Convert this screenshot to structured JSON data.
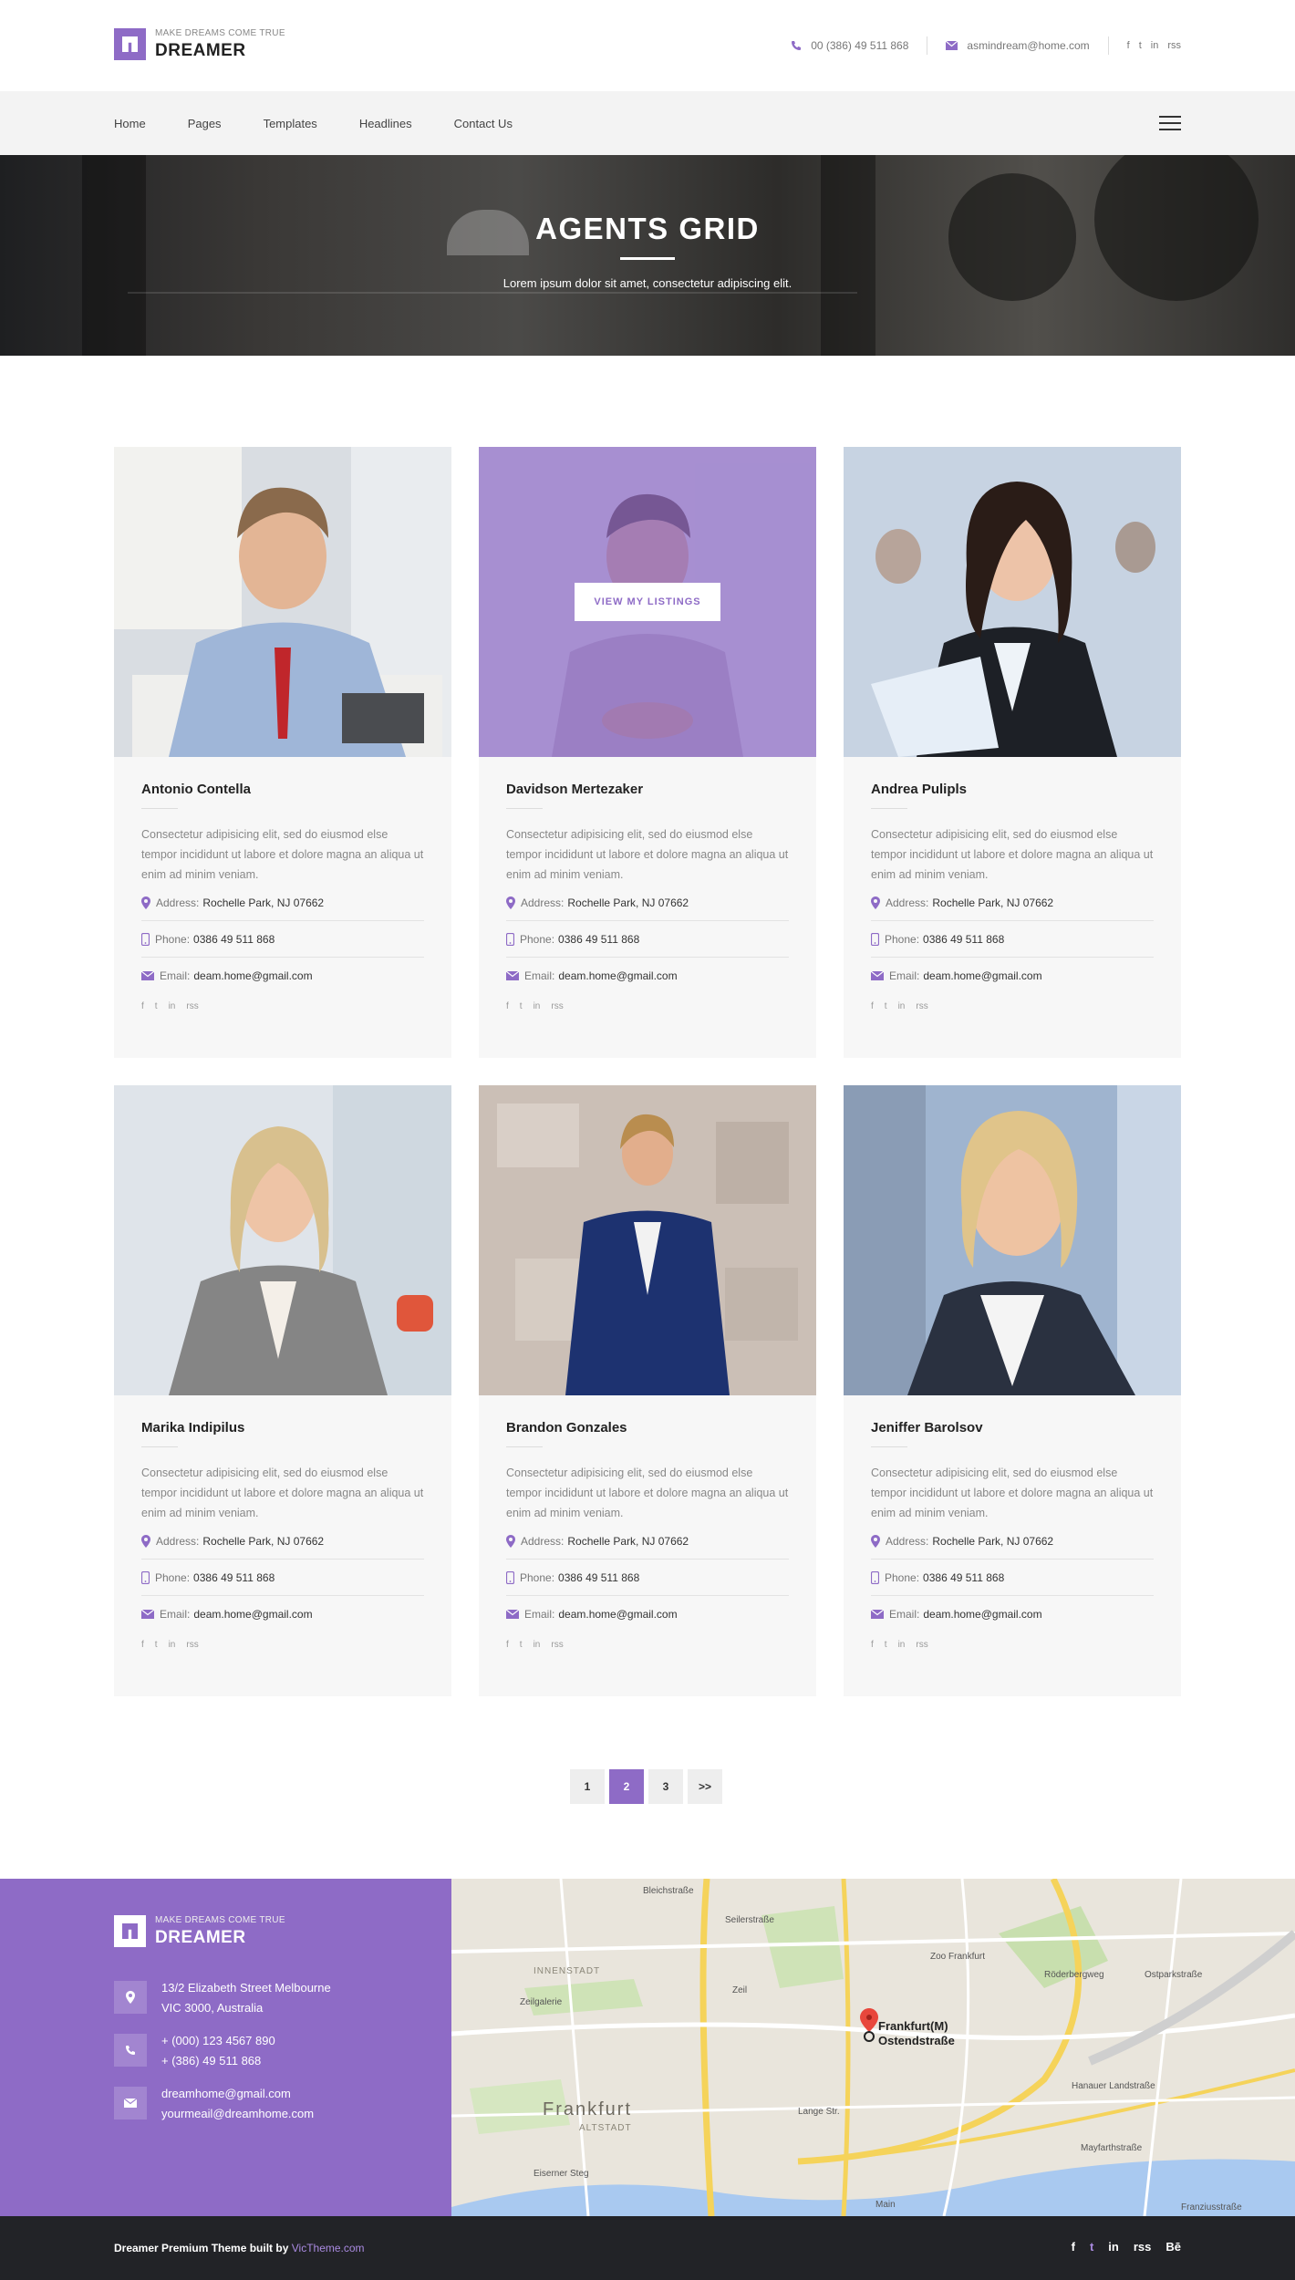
{
  "brand": {
    "tagline": "MAKE DREAMS COME TRUE",
    "name": "DREAMER",
    "accent": "#8e6bc6"
  },
  "topbar": {
    "phone": "00 (386) 49 511 868",
    "email": "asmindream@home.com",
    "social": [
      "f",
      "t",
      "in",
      "rss"
    ]
  },
  "nav": {
    "items": [
      "Home",
      "Pages",
      "Templates",
      "Headlines",
      "Contact Us"
    ]
  },
  "hero": {
    "title": "AGENTS GRID",
    "subtitle": "Lorem ipsum dolor sit amet, consectetur adipiscing elit."
  },
  "agents": [
    {
      "name": "Antonio Contella",
      "desc": "Consectetur adipisicing elit, sed do eiusmod else tempor incididunt ut labore et dolore magna an aliqua ut enim ad minim veniam.",
      "address_label": "Address:",
      "address": "Rochelle Park, NJ 07662",
      "phone_label": "Phone:",
      "phone": "0386 49 511 868",
      "email_label": "Email:",
      "email": "deam.home@gmail.com"
    },
    {
      "name": "Davidson Mertezaker",
      "desc": "Consectetur adipisicing elit, sed do eiusmod else tempor incididunt ut labore et dolore magna an aliqua ut enim ad minim veniam.",
      "address_label": "Address:",
      "address": "Rochelle Park, NJ 07662",
      "phone_label": "Phone:",
      "phone": "0386 49 511 868",
      "email_label": "Email:",
      "email": "deam.home@gmail.com",
      "button": "VIEW MY LISTINGS"
    },
    {
      "name": "Andrea Pulipls",
      "desc": "Consectetur adipisicing elit, sed do eiusmod else tempor incididunt ut labore et dolore magna an aliqua ut enim ad minim veniam.",
      "address_label": "Address:",
      "address": "Rochelle Park, NJ 07662",
      "phone_label": "Phone:",
      "phone": "0386 49 511 868",
      "email_label": "Email:",
      "email": "deam.home@gmail.com"
    },
    {
      "name": "Marika Indipilus",
      "desc": "Consectetur adipisicing elit, sed do eiusmod else tempor incididunt ut labore et dolore magna an aliqua ut enim ad minim veniam.",
      "address_label": "Address:",
      "address": "Rochelle Park, NJ 07662",
      "phone_label": "Phone:",
      "phone": "0386 49 511 868",
      "email_label": "Email:",
      "email": "deam.home@gmail.com"
    },
    {
      "name": "Brandon Gonzales",
      "desc": "Consectetur adipisicing elit, sed do eiusmod else tempor incididunt ut labore et dolore magna an aliqua ut enim ad minim veniam.",
      "address_label": "Address:",
      "address": "Rochelle Park, NJ 07662",
      "phone_label": "Phone:",
      "phone": "0386 49 511 868",
      "email_label": "Email:",
      "email": "deam.home@gmail.com"
    },
    {
      "name": "Jeniffer Barolsov",
      "desc": "Consectetur adipisicing elit, sed do eiusmod else tempor incididunt ut labore et dolore magna an aliqua ut enim ad minim veniam.",
      "address_label": "Address:",
      "address": "Rochelle Park, NJ 07662",
      "phone_label": "Phone:",
      "phone": "0386 49 511 868",
      "email_label": "Email:",
      "email": "deam.home@gmail.com"
    }
  ],
  "card_social": [
    "f",
    "t",
    "in",
    "rss"
  ],
  "pagination": {
    "pages": [
      "1",
      "2",
      "3",
      ">>"
    ],
    "active": "2"
  },
  "footer": {
    "address": [
      "13/2 Elizabeth Street Melbourne",
      "VIC 3000, Australia"
    ],
    "phones": [
      "+ (000) 123 4567 890",
      "+ (386) 49 511 868"
    ],
    "emails": [
      "dreamhome@gmail.com",
      "yourmeail@dreamhome.com"
    ]
  },
  "map": {
    "pin_label": [
      "Frankfurt(M)",
      "Ostendstraße"
    ],
    "city_label": "Frankfurt",
    "district_labels": [
      "INNENSTADT",
      "ALTSTADT"
    ],
    "street_labels": [
      "Zoo Frankfurt",
      "Zeilgalerie",
      "Zeil",
      "Hanauer Landstraße",
      "Eiserner Steg",
      "Main",
      "Röderbergweg",
      "Lange Str.",
      "Mayfarthstraße",
      "Ostparkstraße",
      "Bleichstraße",
      "Seilerstraße",
      "Franziusstraße"
    ]
  },
  "bottombar": {
    "copyright_prefix": "Dreamer Premium Theme built by ",
    "copyright_link": "VicTheme.com",
    "social": [
      "f",
      "t",
      "in",
      "rss",
      "Bē"
    ]
  }
}
